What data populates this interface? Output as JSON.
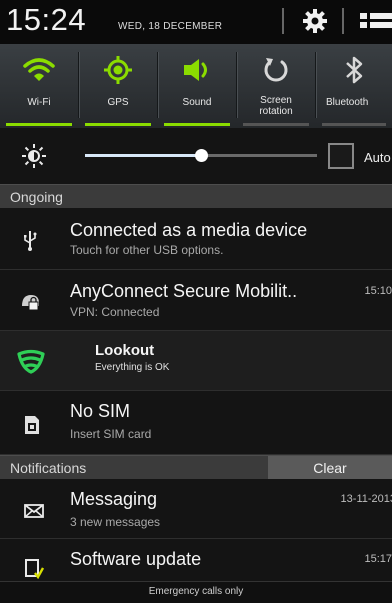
{
  "header": {
    "time": "15:24",
    "date": "WED, 18 DECEMBER"
  },
  "quick_settings": [
    {
      "label": "Wi-Fi",
      "icon": "wifi-icon",
      "on": true
    },
    {
      "label": "GPS",
      "icon": "gps-icon",
      "on": true
    },
    {
      "label": "Sound",
      "icon": "sound-icon",
      "on": true
    },
    {
      "label": "Screen rotation",
      "icon": "rotation-icon",
      "on": false
    },
    {
      "label": "Bluetooth",
      "icon": "bluetooth-icon",
      "on": false
    }
  ],
  "brightness": {
    "level": 0.5,
    "auto_label": "Auto",
    "auto_checked": false
  },
  "ongoing": {
    "header": "Ongoing",
    "items": [
      {
        "title": "Connected as a media device",
        "subtitle": "Touch for other USB options.",
        "icon": "usb-icon",
        "time": ""
      },
      {
        "title": "AnyConnect Secure Mobilit..",
        "subtitle": "VPN: Connected",
        "icon": "anyconnect-icon",
        "time": "15:10"
      },
      {
        "title": "Lookout",
        "subtitle": "Everything is OK",
        "icon": "lookout-icon",
        "time": ""
      },
      {
        "title": "No SIM",
        "subtitle": "Insert SIM card",
        "icon": "sim-card-icon",
        "time": ""
      }
    ]
  },
  "notifications": {
    "header": "Notifications",
    "clear_label": "Clear",
    "items": [
      {
        "title": "Messaging",
        "subtitle": "3 new messages",
        "icon": "envelope-icon",
        "time": "13-11-2013"
      },
      {
        "title": "Software update",
        "subtitle": "",
        "icon": "software-update-icon",
        "time": "15:17"
      }
    ]
  },
  "footer": {
    "emergency": "Emergency calls only"
  },
  "colors": {
    "accent_green": "#8bdc00",
    "lookout_green": "#2fcf57"
  }
}
